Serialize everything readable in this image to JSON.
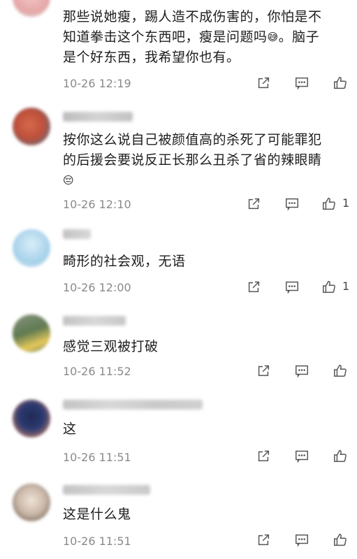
{
  "comments": [
    {
      "text_lines": [
        "那些说她瘦，踢人造不成伤害的，你怕是不",
        "知道拳击这个东西吧，瘦是问题吗",
        "是个好东西，我希望你也有。"
      ],
      "inline_after_line2": "。脑子",
      "timestamp": "10-26 12:19",
      "likes": ""
    },
    {
      "text_lines": [
        "按你这么说自己被颜值高的杀死了可能罪犯",
        "的后援会要说反正长那么丑杀了省的辣眼睛"
      ],
      "timestamp": "10-26 12:10",
      "likes": "1"
    },
    {
      "text_lines": [
        "畸形的社会观，无语"
      ],
      "timestamp": "10-26 12:00",
      "likes": "1"
    },
    {
      "text_lines": [
        "感觉三观被打破"
      ],
      "timestamp": "10-26 11:52",
      "likes": ""
    },
    {
      "text_lines": [
        "这"
      ],
      "timestamp": "10-26 11:51",
      "likes": ""
    },
    {
      "text_lines": [
        "这是什么鬼"
      ],
      "timestamp": "10-26 11:51",
      "likes": ""
    }
  ],
  "icons": {
    "share": "share-icon",
    "reply": "comment-icon",
    "like": "thumbs-up-icon"
  },
  "colors": {
    "icon": "#555555",
    "timestamp": "#8a8a8a",
    "text": "#1d1d1d"
  }
}
